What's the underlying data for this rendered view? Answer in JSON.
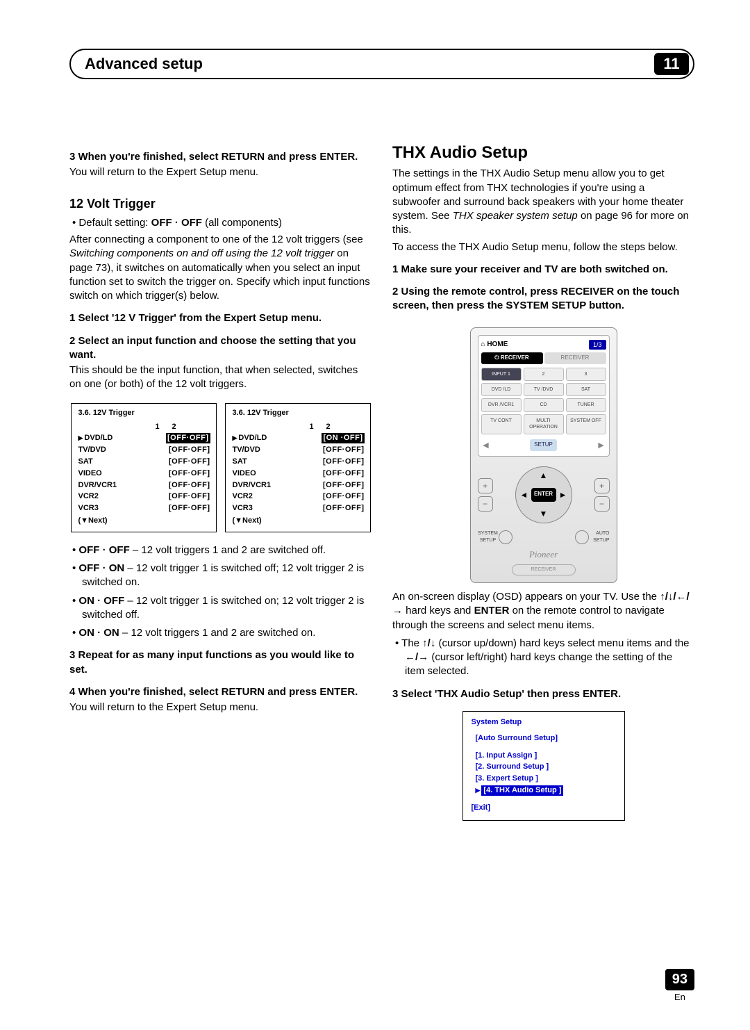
{
  "header": {
    "title": "Advanced setup",
    "chapter": "11"
  },
  "left": {
    "step3a": "3   When you're finished, select RETURN and press ENTER.",
    "step3a_body": "You will return to the Expert Setup menu.",
    "sect_title": "12 Volt Trigger",
    "default_line": "Default setting: ",
    "default_bold": "OFF · OFF",
    "default_tail": " (all components)",
    "intro1": "After connecting a component to one of the 12 volt triggers (see ",
    "intro_em": "Switching components on and off using the 12 volt trigger",
    "intro2": " on page 73), it switches on automatically when you select an input function set to switch the trigger on. Specify which input functions switch on which trigger(s) below.",
    "s1": "1   Select '12 V Trigger' from the Expert Setup menu.",
    "s2": "2   Select an input function and choose the setting that you want.",
    "s2_body": "This should be the input function, that when selected, switches on one (or both) of the 12 volt triggers.",
    "osd_title": "3.6. 12V Trigger",
    "osd_head1": "1",
    "osd_head2": "2",
    "osd_rows": [
      "DVD/LD",
      "TV/DVD",
      "SAT",
      "VIDEO",
      "DVR/VCR1",
      "VCR2",
      "VCR3"
    ],
    "osd_val_off": "[OFF·OFF]",
    "osd_val_on": "[ON ·OFF]",
    "osd_next": "(▼Next)",
    "b1a": "OFF · OFF",
    "b1b": " – 12 volt triggers 1 and 2 are switched off.",
    "b2a": "OFF · ON",
    "b2b": " – 12 volt trigger 1 is switched off; 12 volt trigger 2 is switched on.",
    "b3a": "ON · OFF",
    "b3b": " – 12 volt trigger 1 is switched on; 12 volt trigger 2 is switched off.",
    "b4a": "ON · ON",
    "b4b": " – 12 volt triggers 1 and 2 are switched on.",
    "s3": "3   Repeat for as many input functions as you would like to set.",
    "s4": "4   When you're finished, select RETURN and press ENTER.",
    "s4_body": "You will return to the Expert Setup menu."
  },
  "right": {
    "title": "THX Audio Setup",
    "p1a": "The settings in the THX Audio Setup menu allow you to get optimum effect from THX technologies if you're using a subwoofer and surround back speakers with your home theater system. See ",
    "p1em": "THX speaker system setup",
    "p1b": " on page 96 for more on this.",
    "p2": "To access the THX Audio Setup menu, follow the steps below.",
    "s1": "1   Make sure your receiver and TV are both switched on.",
    "s2": "2   Using the remote control, press RECEIVER on the touch screen, then press the SYSTEM SETUP button.",
    "remote": {
      "home": "HOME",
      "page": "1/3",
      "tab_receiver": "⏻ RECEIVER",
      "tab_other": "RECEIVER",
      "row1": [
        "INPUT 1",
        "2",
        "3"
      ],
      "row2": [
        "DVD /LD",
        "TV /DVD",
        "SAT"
      ],
      "row3": [
        "DVR /VCR1",
        "CD",
        "TUNER"
      ],
      "row4": [
        "TV CONT",
        "MULTI OPERATION",
        "SYSTEM OFF"
      ],
      "setup": "SETUP",
      "enter": "ENTER",
      "brand": "Pioneer",
      "bottom_l": "SYSTEM SETUP",
      "bottom_r": "AUTO SETUP",
      "pill": "RECEIVER"
    },
    "p3a": "An on-screen display (OSD) appears on your TV. Use the ",
    "p3arrows": "↑/↓/←/→",
    "p3b": " hard keys and ",
    "p3enter": "ENTER",
    "p3c": " on the remote control to navigate through the screens and select menu items.",
    "b_pre": "The ",
    "b_ud": "↑/↓",
    "b_mid1": " (cursor up/down) hard keys select menu items and the ",
    "b_lr": "←/→",
    "b_mid2": " (cursor left/right) hard keys change the setting of the item selected.",
    "s3": "3   Select 'THX Audio Setup' then press ENTER.",
    "ss": {
      "title": "System Setup",
      "auto": "[Auto Surround Setup]",
      "l1": "[1. Input Assign ]",
      "l2": "[2. Surround Setup ]",
      "l3": "[3. Expert Setup ]",
      "l4": "[4. THX Audio Setup ]",
      "exit": "[Exit]"
    }
  },
  "pagenum": {
    "num": "93",
    "lang": "En"
  }
}
